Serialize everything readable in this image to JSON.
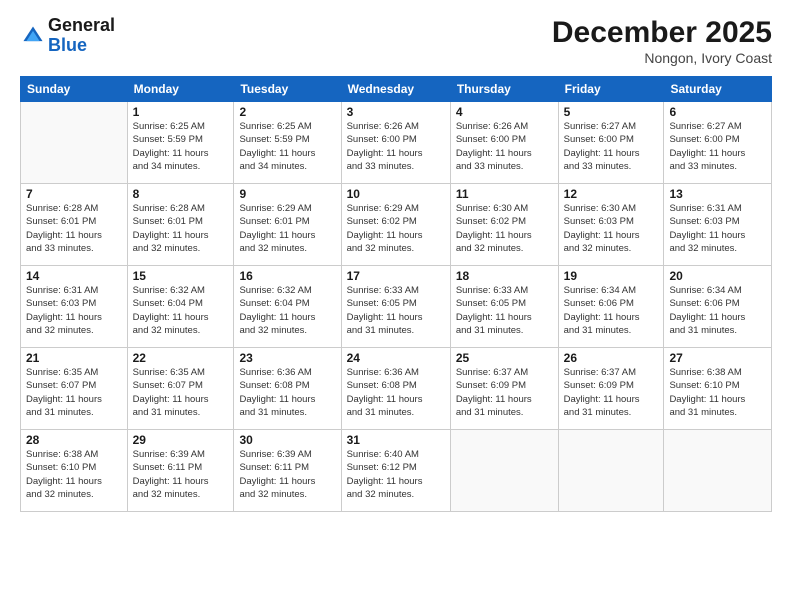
{
  "header": {
    "logo_line1": "General",
    "logo_line2": "Blue",
    "month": "December 2025",
    "location": "Nongon, Ivory Coast"
  },
  "weekdays": [
    "Sunday",
    "Monday",
    "Tuesday",
    "Wednesday",
    "Thursday",
    "Friday",
    "Saturday"
  ],
  "weeks": [
    [
      {
        "day": "",
        "info": ""
      },
      {
        "day": "1",
        "info": "Sunrise: 6:25 AM\nSunset: 5:59 PM\nDaylight: 11 hours\nand 34 minutes."
      },
      {
        "day": "2",
        "info": "Sunrise: 6:25 AM\nSunset: 5:59 PM\nDaylight: 11 hours\nand 34 minutes."
      },
      {
        "day": "3",
        "info": "Sunrise: 6:26 AM\nSunset: 6:00 PM\nDaylight: 11 hours\nand 33 minutes."
      },
      {
        "day": "4",
        "info": "Sunrise: 6:26 AM\nSunset: 6:00 PM\nDaylight: 11 hours\nand 33 minutes."
      },
      {
        "day": "5",
        "info": "Sunrise: 6:27 AM\nSunset: 6:00 PM\nDaylight: 11 hours\nand 33 minutes."
      },
      {
        "day": "6",
        "info": "Sunrise: 6:27 AM\nSunset: 6:00 PM\nDaylight: 11 hours\nand 33 minutes."
      }
    ],
    [
      {
        "day": "7",
        "info": "Sunrise: 6:28 AM\nSunset: 6:01 PM\nDaylight: 11 hours\nand 33 minutes."
      },
      {
        "day": "8",
        "info": "Sunrise: 6:28 AM\nSunset: 6:01 PM\nDaylight: 11 hours\nand 32 minutes."
      },
      {
        "day": "9",
        "info": "Sunrise: 6:29 AM\nSunset: 6:01 PM\nDaylight: 11 hours\nand 32 minutes."
      },
      {
        "day": "10",
        "info": "Sunrise: 6:29 AM\nSunset: 6:02 PM\nDaylight: 11 hours\nand 32 minutes."
      },
      {
        "day": "11",
        "info": "Sunrise: 6:30 AM\nSunset: 6:02 PM\nDaylight: 11 hours\nand 32 minutes."
      },
      {
        "day": "12",
        "info": "Sunrise: 6:30 AM\nSunset: 6:03 PM\nDaylight: 11 hours\nand 32 minutes."
      },
      {
        "day": "13",
        "info": "Sunrise: 6:31 AM\nSunset: 6:03 PM\nDaylight: 11 hours\nand 32 minutes."
      }
    ],
    [
      {
        "day": "14",
        "info": "Sunrise: 6:31 AM\nSunset: 6:03 PM\nDaylight: 11 hours\nand 32 minutes."
      },
      {
        "day": "15",
        "info": "Sunrise: 6:32 AM\nSunset: 6:04 PM\nDaylight: 11 hours\nand 32 minutes."
      },
      {
        "day": "16",
        "info": "Sunrise: 6:32 AM\nSunset: 6:04 PM\nDaylight: 11 hours\nand 32 minutes."
      },
      {
        "day": "17",
        "info": "Sunrise: 6:33 AM\nSunset: 6:05 PM\nDaylight: 11 hours\nand 31 minutes."
      },
      {
        "day": "18",
        "info": "Sunrise: 6:33 AM\nSunset: 6:05 PM\nDaylight: 11 hours\nand 31 minutes."
      },
      {
        "day": "19",
        "info": "Sunrise: 6:34 AM\nSunset: 6:06 PM\nDaylight: 11 hours\nand 31 minutes."
      },
      {
        "day": "20",
        "info": "Sunrise: 6:34 AM\nSunset: 6:06 PM\nDaylight: 11 hours\nand 31 minutes."
      }
    ],
    [
      {
        "day": "21",
        "info": "Sunrise: 6:35 AM\nSunset: 6:07 PM\nDaylight: 11 hours\nand 31 minutes."
      },
      {
        "day": "22",
        "info": "Sunrise: 6:35 AM\nSunset: 6:07 PM\nDaylight: 11 hours\nand 31 minutes."
      },
      {
        "day": "23",
        "info": "Sunrise: 6:36 AM\nSunset: 6:08 PM\nDaylight: 11 hours\nand 31 minutes."
      },
      {
        "day": "24",
        "info": "Sunrise: 6:36 AM\nSunset: 6:08 PM\nDaylight: 11 hours\nand 31 minutes."
      },
      {
        "day": "25",
        "info": "Sunrise: 6:37 AM\nSunset: 6:09 PM\nDaylight: 11 hours\nand 31 minutes."
      },
      {
        "day": "26",
        "info": "Sunrise: 6:37 AM\nSunset: 6:09 PM\nDaylight: 11 hours\nand 31 minutes."
      },
      {
        "day": "27",
        "info": "Sunrise: 6:38 AM\nSunset: 6:10 PM\nDaylight: 11 hours\nand 31 minutes."
      }
    ],
    [
      {
        "day": "28",
        "info": "Sunrise: 6:38 AM\nSunset: 6:10 PM\nDaylight: 11 hours\nand 32 minutes."
      },
      {
        "day": "29",
        "info": "Sunrise: 6:39 AM\nSunset: 6:11 PM\nDaylight: 11 hours\nand 32 minutes."
      },
      {
        "day": "30",
        "info": "Sunrise: 6:39 AM\nSunset: 6:11 PM\nDaylight: 11 hours\nand 32 minutes."
      },
      {
        "day": "31",
        "info": "Sunrise: 6:40 AM\nSunset: 6:12 PM\nDaylight: 11 hours\nand 32 minutes."
      },
      {
        "day": "",
        "info": ""
      },
      {
        "day": "",
        "info": ""
      },
      {
        "day": "",
        "info": ""
      }
    ]
  ]
}
